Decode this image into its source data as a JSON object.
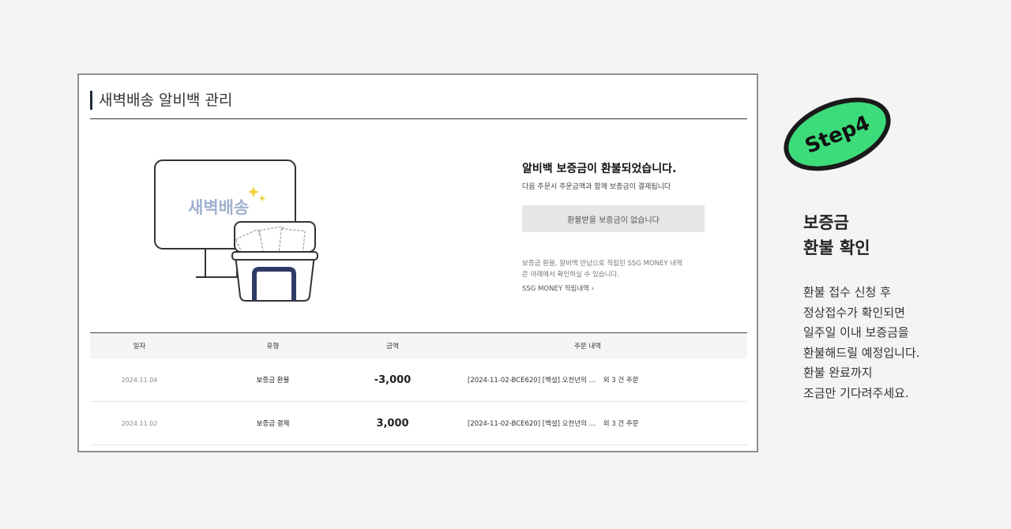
{
  "panel": {
    "title": "새벽배송 알비백 관리",
    "illustration_text": "새벽배송",
    "info": {
      "title": "알비백 보증금이 환불되었습니다.",
      "subtitle": "다음 주문시 주문금액과 함께 보증금이 결제됩니다",
      "button_label": "환불받을 보증금이 없습니다",
      "notice_line1": "보증금 환불, 알비백 반납으로 적립된 SSG MONEY 내역",
      "notice_line2": "은 아래에서 확인하실 수 있습니다.",
      "link_label": "SSG MONEY 적립내역 ›"
    },
    "table": {
      "headers": {
        "date": "일자",
        "type": "유형",
        "amount": "금액",
        "order": "주문 내역"
      },
      "rows": [
        {
          "date": "2024.11.04",
          "type": "보증금 환불",
          "amount": "-3,000",
          "order": "[2024-11-02-BCE620] [백설] 오천년의 ...",
          "extra": "외 3 건 주문"
        },
        {
          "date": "2024.11.02",
          "type": "보증금 결제",
          "amount": "3,000",
          "order": "[2024-11-02-BCE620] [백설] 오천년의 ...",
          "extra": "외 3 건 주문"
        }
      ]
    }
  },
  "step_badge": {
    "label": "Step4",
    "color": "#3ddc7a"
  },
  "side": {
    "heading_line1": "보증금",
    "heading_line2": "환불 확인",
    "desc": [
      "환불 접수 신청 후",
      "정상접수가 확인되면",
      "일주일 이내 보증금을",
      "환불해드릴 예정입니다.",
      "환불 완료까지",
      "조금만 기다려주세요."
    ]
  }
}
